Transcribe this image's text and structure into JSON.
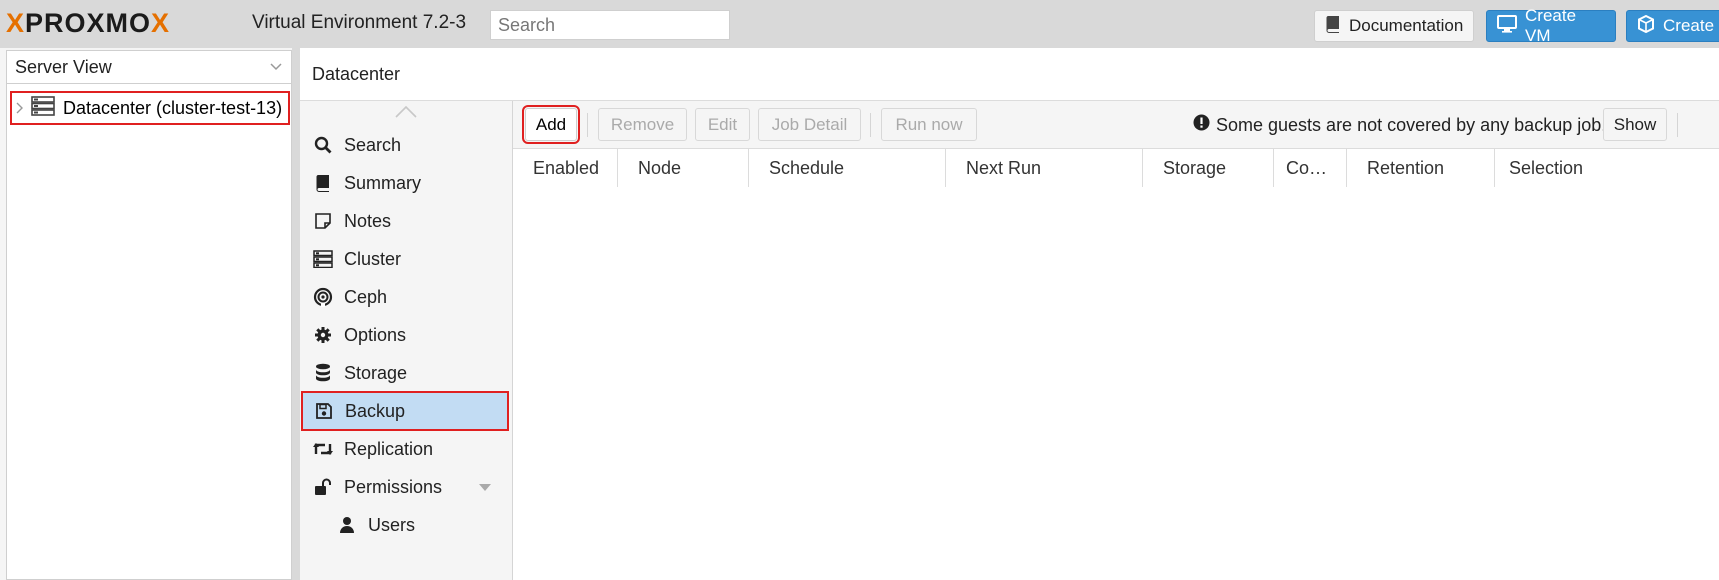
{
  "header": {
    "logo_x1": "X",
    "logo_mid": "PROXMO",
    "logo_x2": "X",
    "title": "Virtual Environment 7.2-3",
    "search_placeholder": "Search",
    "documentation_label": "Documentation",
    "create_vm_label": "Create VM",
    "create_ct_label": "Create C"
  },
  "tree": {
    "view_label": "Server View",
    "node_label": "Datacenter (cluster-test-13)"
  },
  "panel": {
    "title": "Datacenter"
  },
  "nav": {
    "items": [
      {
        "label": "Search",
        "icon": "search-icon"
      },
      {
        "label": "Summary",
        "icon": "book-icon"
      },
      {
        "label": "Notes",
        "icon": "note-icon"
      },
      {
        "label": "Cluster",
        "icon": "server-icon"
      },
      {
        "label": "Ceph",
        "icon": "ceph-icon"
      },
      {
        "label": "Options",
        "icon": "gear-icon"
      },
      {
        "label": "Storage",
        "icon": "database-icon"
      },
      {
        "label": "Backup",
        "icon": "floppy-icon"
      },
      {
        "label": "Replication",
        "icon": "retweet-icon"
      },
      {
        "label": "Permissions",
        "icon": "unlock-icon"
      },
      {
        "label": "Users",
        "icon": "user-icon"
      }
    ]
  },
  "toolbar": {
    "add": "Add",
    "remove": "Remove",
    "edit": "Edit",
    "job_detail": "Job Detail",
    "run_now": "Run now",
    "notice": "Some guests are not covered by any backup job.",
    "show": "Show"
  },
  "grid": {
    "columns": [
      "Enabled",
      "Node",
      "Schedule",
      "Next Run",
      "Storage",
      "Co…",
      "Retention",
      "Selection"
    ]
  },
  "colors": {
    "accent": "#3892d4",
    "logo_orange": "#e57000",
    "selected_row": "#c2dcf3",
    "highlight_outline": "#e02020"
  }
}
